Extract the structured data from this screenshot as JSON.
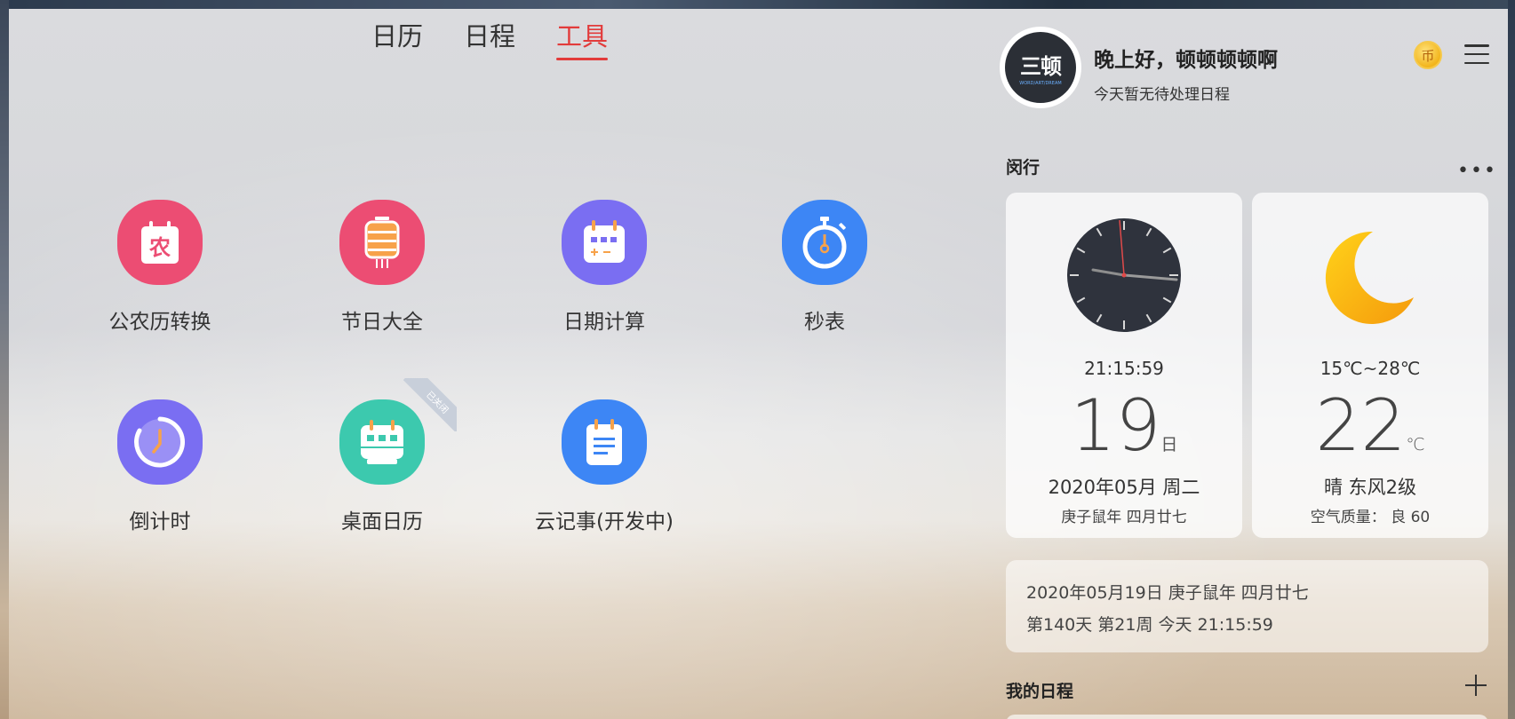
{
  "tabs": [
    {
      "label": "日历",
      "active": false
    },
    {
      "label": "日程",
      "active": false
    },
    {
      "label": "工具",
      "active": true
    }
  ],
  "tools": [
    {
      "label": "公农历转换",
      "icon": "lunar-calendar-icon",
      "color": "#ec4d73",
      "glyph": "农"
    },
    {
      "label": "节日大全",
      "icon": "lantern-icon",
      "color": "#ec4d73"
    },
    {
      "label": "日期计算",
      "icon": "date-calculator-icon",
      "color": "#7a6ef2"
    },
    {
      "label": "秒表",
      "icon": "stopwatch-icon",
      "color": "#3d86f5"
    },
    {
      "label": "倒计时",
      "icon": "countdown-icon",
      "color": "#7a6ef2"
    },
    {
      "label": "桌面日历",
      "icon": "desktop-calendar-icon",
      "color": "#3cc9ae",
      "ribbon": "已关闭"
    },
    {
      "label": "云记事(开发中)",
      "icon": "cloud-note-icon",
      "color": "#3d86f5"
    }
  ],
  "profile": {
    "avatar_text": "三顿",
    "avatar_subtext": "WORD/ART/DREAM",
    "greeting": "晚上好，顿顿顿顿啊",
    "subtitle": "今天暂无待处理日程"
  },
  "coin_label": "币",
  "section_yuexing": "闵行",
  "clock_card": {
    "time": "21:15:59",
    "day": "19",
    "day_unit": "日",
    "date_line": "2020年05月 周二",
    "lunar_line": "庚子鼠年 四月廿七"
  },
  "weather_card": {
    "range": "15℃~28℃",
    "temp": "22",
    "temp_unit": "℃",
    "condition": "晴 东风2级",
    "air_quality": "空气质量： 良 60",
    "icon": "moon-icon"
  },
  "info_card": {
    "row1": "2020年05月19日 庚子鼠年 四月廿七",
    "row2": "第140天 第21周 今天 21:15:59"
  },
  "section_schedule": "我的日程",
  "colors": {
    "accent": "#e23b3b",
    "pink": "#ec4d73",
    "purple": "#7a6ef2",
    "blue": "#3d86f5",
    "teal": "#3cc9ae"
  }
}
